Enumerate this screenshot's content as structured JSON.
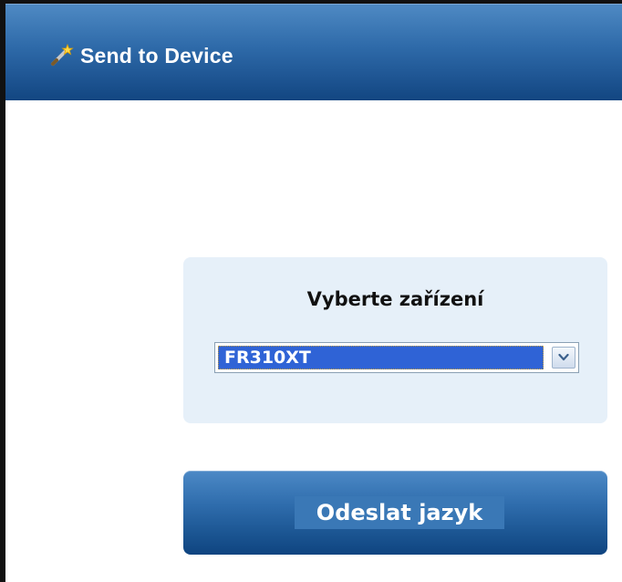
{
  "window": {
    "title": "Send to Device",
    "icon": "magic-wand-icon"
  },
  "panel": {
    "label": "Vyberte zařízení",
    "device_select": {
      "selected": "FR310XT",
      "icon": "chevron-down-icon"
    }
  },
  "actions": {
    "send_label": "Odeslat jazyk"
  },
  "colors": {
    "titlebar": "#2e6aa9",
    "panel_bg": "#e6f0f9",
    "selection": "#2f63d6",
    "button": "#1b5592"
  }
}
